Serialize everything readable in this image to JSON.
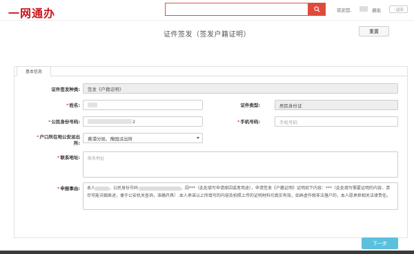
{
  "header": {
    "logo": "一网通办",
    "search_placeholder": "",
    "welcome": "欢迎您,",
    "logout": "退出",
    "back": "返回"
  },
  "page": {
    "title": "证件签发（签发户籍证明）",
    "reset_label": "重置",
    "tab_label": "基本信息",
    "next_label": "下一步"
  },
  "form": {
    "cert_type_label": "证件签发种类:",
    "cert_type_value": "签发《户籍证明》",
    "name_label": "姓名:",
    "id_type_label": "证件类型:",
    "id_type_value": "居民身份证",
    "id_number_label": "公民身份号码:",
    "id_number_tail": "2",
    "phone_label": "手机号码:",
    "phone_placeholder": "手机号码",
    "police_station_label_1": "户口所在地公安派出",
    "police_station_label_2": "所:",
    "police_station_value": "黄浦分局、豫园派出所",
    "address_label": "联系地址:",
    "address_placeholder": "联系地址",
    "reason_label": "申报事由:",
    "reason_p1": "本人",
    "reason_p2": "，公民身份号码:",
    "reason_p3": "，因***（此处填写申请原因或者用途），申请签发《户籍证明》证明如下内容：***（此处填写需要证明的内容，请尽可能详细表述，便于公安机关查询，准确开具）.本人承诺以上所填写的内容及拍照上传的证明材料均真实有效，如弄虚作假非法落户的，本人愿承担相关法律责任。"
  }
}
